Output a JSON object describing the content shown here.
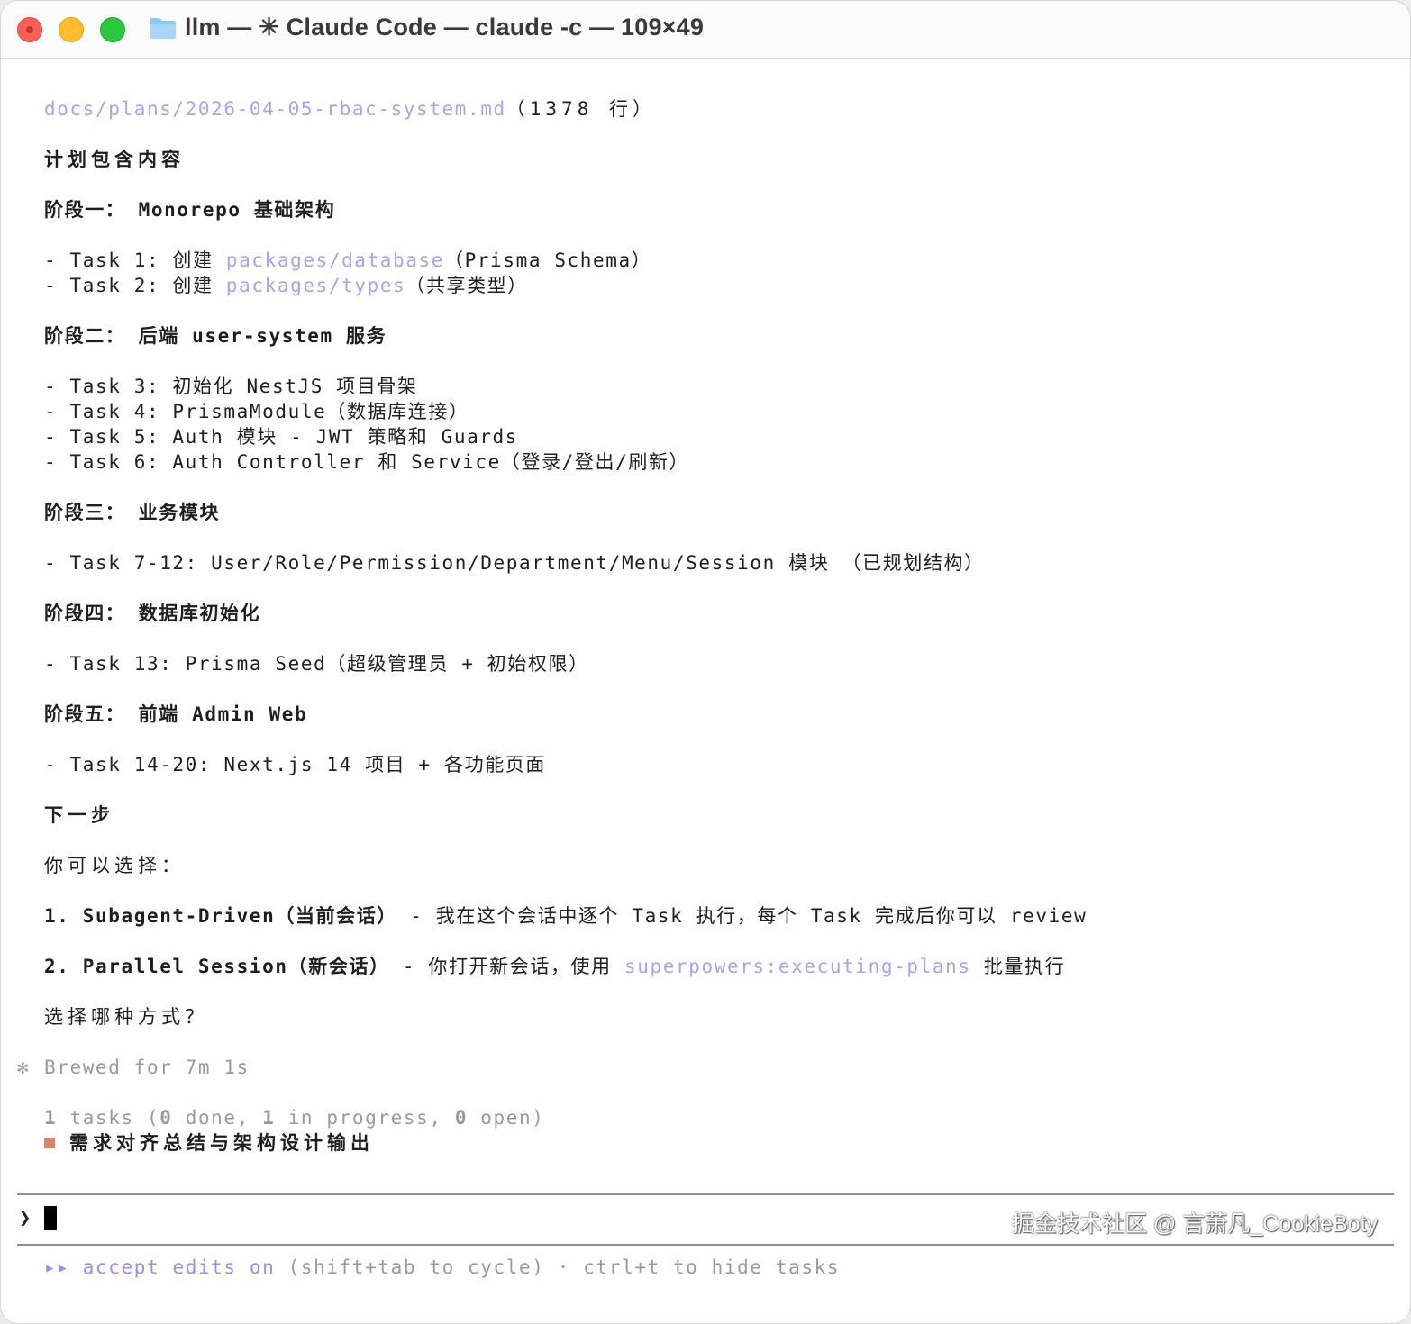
{
  "window": {
    "title": "llm — ✳ Claude Code — claude -c — 109×49",
    "colors": {
      "close": "#ff5f57",
      "minimize": "#febc2e",
      "zoom": "#28c840",
      "link": "#a3a6ee",
      "accent": "#9d8cf0",
      "task_marker": "#d9836b"
    }
  },
  "output": {
    "file_path": "docs/plans/2026-04-05-rbac-system.md",
    "file_lines": "（1378 行）",
    "plan_heading": "计划包含内容",
    "phase1": {
      "heading": "阶段一： Monorepo 基础架构",
      "task1_prefix": "- Task 1: 创建 ",
      "task1_path": "packages/database",
      "task1_suffix": "（Prisma Schema）",
      "task2_prefix": "- Task 2: 创建 ",
      "task2_path": "packages/types",
      "task2_suffix": "（共享类型）"
    },
    "phase2": {
      "heading": "阶段二： 后端 user-system 服务",
      "tasks": [
        "- Task 3: 初始化 NestJS 项目骨架",
        "- Task 4: PrismaModule（数据库连接）",
        "- Task 5: Auth 模块 - JWT 策略和 Guards",
        "- Task 6: Auth Controller 和 Service（登录/登出/刷新）"
      ]
    },
    "phase3": {
      "heading": "阶段三： 业务模块",
      "task": "- Task 7-12: User/Role/Permission/Department/Menu/Session 模块 （已规划结构）"
    },
    "phase4": {
      "heading": "阶段四： 数据库初始化",
      "task": "- Task 13: Prisma Seed（超级管理员 + 初始权限）"
    },
    "phase5": {
      "heading": "阶段五： 前端 Admin Web",
      "task": "- Task 14-20: Next.js 14 项目 + 各功能页面"
    },
    "next_heading": "下一步",
    "choose_text": "你可以选择：",
    "option1_bold": "1. Subagent-Driven（当前会话）",
    "option1_rest": " - 我在这个会话中逐个 Task 执行，每个 Task 完成后你可以 review",
    "option2_bold": "2. Parallel Session（新会话）",
    "option2_mid": " - 你打开新会话，使用 ",
    "option2_link": "superpowers:executing-plans",
    "option2_end": " 批量执行",
    "question": "选择哪种方式？"
  },
  "status": {
    "spinner": "✻",
    "brewed": "Brewed for 7m 1s",
    "tasks_count": "1",
    "tasks_label": " tasks (",
    "done_count": "0",
    "done_label": " done, ",
    "progress_count": "1",
    "progress_label": " in progress, ",
    "open_count": "0",
    "open_label": " open)",
    "current_task": "需求对齐总结与架构设计输出"
  },
  "input": {
    "caret": "❯"
  },
  "footer": {
    "mode_icon": "▸▸",
    "mode_label": "accept edits on",
    "hint": " (shift+tab to cycle) · ctrl+t to hide tasks"
  },
  "watermark": "掘金技术社区 @ 言萧凡_CookieBoty"
}
